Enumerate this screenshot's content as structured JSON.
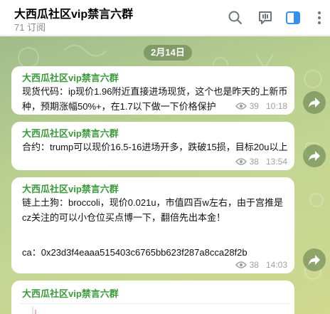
{
  "header": {
    "title": "大西瓜社区vip禁言六群",
    "subtitle": "71 订阅",
    "icons": [
      "search-icon",
      "live-chat-icon",
      "sidebar-toggle-icon",
      "more-icon"
    ],
    "accent_color": "#3390ec"
  },
  "chat": {
    "date_label": "2月14日",
    "sender_color": "#3a9a3a",
    "messages": [
      {
        "sender": "大西瓜社区vip禁言六群",
        "text": "现货代码：ip现价1.96附近直接进场现货，这个也是昨天的上新币种，预期涨幅50%+，在1.7以下做一下价格保护",
        "views": "39",
        "time": "10:18"
      },
      {
        "sender": "大西瓜社区vip禁言六群",
        "text": "合约：trump可以现价16.5-16进场开多，跌破15损，目标20u以上",
        "views": "38",
        "time": "13:54"
      },
      {
        "sender": "大西瓜社区vip禁言六群",
        "text": "链上土狗：broccoli，现价0.021u，市值四百w左右，由于宫推是cz关注的可以小仓位买点博一下，翻倍先出本金！",
        "text2": "ca：0x23d3f4eaaa515403c6765bb623f287a8cca28f2b",
        "views": "38",
        "time": "14:03"
      },
      {
        "sender": "大西瓜社区vip禁言六群"
      }
    ]
  }
}
